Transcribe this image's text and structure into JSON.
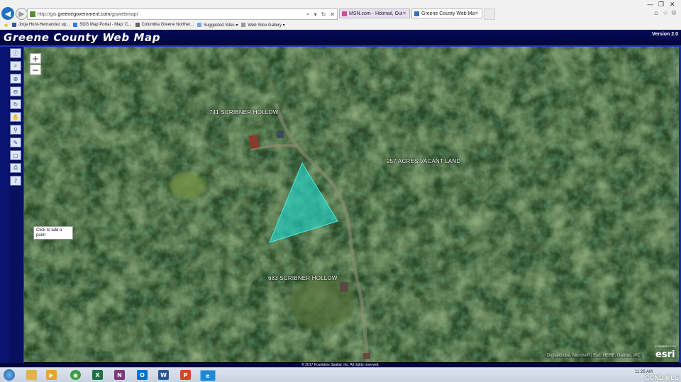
{
  "browser": {
    "back_icon": "back-arrow-icon",
    "forward_icon": "forward-arrow-icon",
    "address": {
      "url_prefix": "http://gis.",
      "url_domain": "greenegovernment.com",
      "url_suffix": "/giswebmap/"
    },
    "address_controls": [
      "⌕",
      "▾",
      "↻",
      "✕"
    ],
    "tabs": [
      {
        "title": "MSN.com - Hotmail, Outlook,...",
        "close": "✕"
      },
      {
        "title": "Greene County Web Map",
        "close": "✕"
      }
    ],
    "window_controls": [
      "—",
      "❐",
      "✕"
    ],
    "toolbar_icons": [
      "⌂",
      "☆",
      "⚙"
    ]
  },
  "favorites_bar": {
    "items": [
      {
        "label": "Jorja Hunt-Hernandez up...",
        "icon_color": "#3b5998"
      },
      {
        "label": "SDG Map Portal - Map :C...",
        "icon_color": "#2f7ed8"
      },
      {
        "label": "Columbia Greene Norther...",
        "icon_color": "#666666"
      },
      {
        "label": "Suggested Sites ▾",
        "icon_color": "#7aa3d6"
      },
      {
        "label": "Web Slice Gallery ▾",
        "icon_color": "#999999"
      }
    ]
  },
  "app": {
    "title": "Greene County Web Map",
    "version": "Version 2.0",
    "header_color": "#030a5a"
  },
  "tools": [
    {
      "name": "identify-tool",
      "glyph": "ⓘ"
    },
    {
      "name": "search-tool",
      "glyph": "⌕"
    },
    {
      "name": "zoom-in-tool",
      "glyph": "⊕"
    },
    {
      "name": "zoom-out-tool",
      "glyph": "⊖"
    },
    {
      "name": "refresh-tool",
      "glyph": "↻"
    },
    {
      "name": "pan-tool",
      "glyph": "✋"
    },
    {
      "name": "measure-tool",
      "glyph": "⚲"
    },
    {
      "name": "draw-tool",
      "glyph": "✎"
    },
    {
      "name": "select-tool",
      "glyph": "▢"
    },
    {
      "name": "print-tool",
      "glyph": "⎙"
    },
    {
      "name": "help-tool",
      "glyph": "?"
    }
  ],
  "map": {
    "zoom_in": "+",
    "zoom_out": "−",
    "labels": {
      "north": "741 SCRIBNER HOLLOW",
      "east": "257 ACRES VACANT LAND",
      "south": "683 SCRIBNER HOLLOW"
    },
    "tooltip": "Click to add a point",
    "polygon_fill": "#22d3c8",
    "attribution": "DigitalGlobe, Microsoft | Esri, HERE, Garmin, iPC",
    "esri_powered": "POWERED BY",
    "esri_word": "esri"
  },
  "footer": {
    "copyright": "© 2017 Fountains Spatial, Inc. All rights reserved."
  },
  "taskbar": {
    "start_icon": "windows-start-icon",
    "apps": [
      {
        "name": "explorer",
        "color": "#e3b24a",
        "glyph": ""
      },
      {
        "name": "media",
        "color": "#f0a030",
        "glyph": "▶"
      },
      {
        "name": "chrome",
        "color": "#3b9c3e",
        "glyph": "◉"
      },
      {
        "name": "excel",
        "color": "#1e7145",
        "glyph": "X"
      },
      {
        "name": "onenote",
        "color": "#80397b",
        "glyph": "N"
      },
      {
        "name": "outlook",
        "color": "#0072c6",
        "glyph": "O"
      },
      {
        "name": "word",
        "color": "#2b579a",
        "glyph": "W"
      },
      {
        "name": "powerpoint",
        "color": "#d24726",
        "glyph": "P"
      },
      {
        "name": "internet-explorer",
        "color": "#1e88d4",
        "glyph": "e"
      }
    ],
    "time": "11:26 AM",
    "watermark": "CCND MLS"
  }
}
